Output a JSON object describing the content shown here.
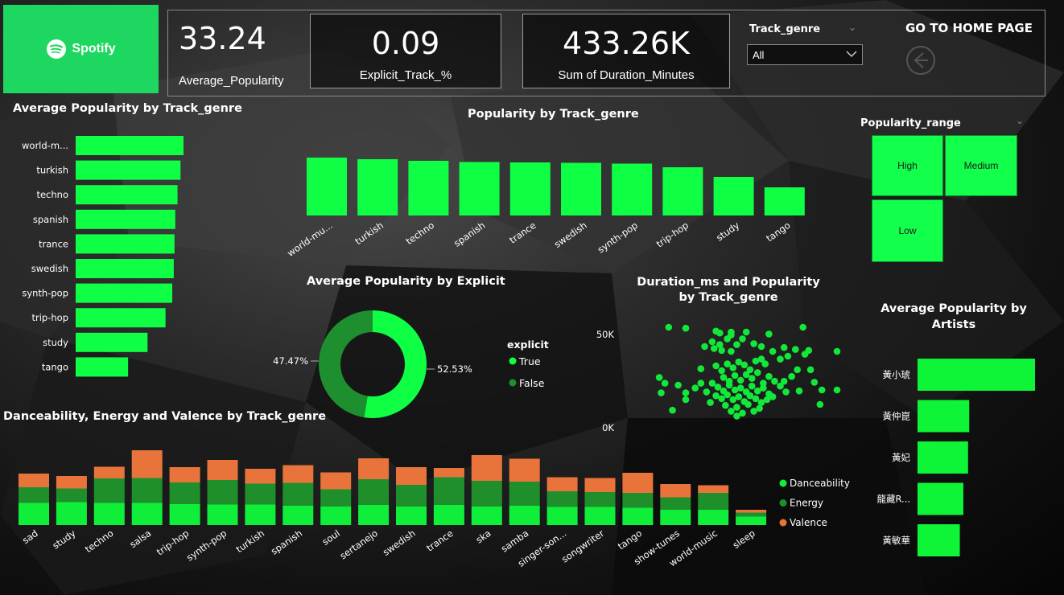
{
  "brand": {
    "name": "Spotify",
    "color": "#1ed760"
  },
  "colors": {
    "bar": "#0fff45",
    "donut_true": "#0fff45",
    "donut_false": "#1e8f2f",
    "dance": "#0fef3a",
    "energy": "#1f8f2c",
    "valence": "#e8743b",
    "scatter": "#12e83a"
  },
  "kpis": [
    {
      "value": "33.24",
      "label": "Average_Popularity"
    },
    {
      "value": "0.09",
      "label": "Explicit_Track_%"
    },
    {
      "value": "433.26K",
      "label": "Sum of Duration_Minutes"
    }
  ],
  "filter": {
    "label": "Track_genre",
    "selected": "All"
  },
  "home": {
    "label": "GO TO HOME PAGE",
    "icon": "arrow-left-circle-icon"
  },
  "popularity_range": {
    "title": "Popularity_range",
    "tiles": [
      "High",
      "Medium",
      "Low"
    ]
  },
  "chart_data": [
    {
      "id": "avg_pop_genre",
      "type": "bar",
      "orientation": "horizontal",
      "title": "Average Popularity by Track_genre",
      "categories": [
        "world-m...",
        "turkish",
        "techno",
        "spanish",
        "trance",
        "swedish",
        "synth-pop",
        "trip-hop",
        "study",
        "tango"
      ],
      "values": [
        72,
        70,
        68,
        66.5,
        66,
        65.5,
        64.5,
        60,
        48,
        35
      ],
      "xlim": [
        0,
        75
      ]
    },
    {
      "id": "pop_genre",
      "type": "bar",
      "title": "Popularity by Track_genre",
      "categories": [
        "world-mu...",
        "turkish",
        "techno",
        "spanish",
        "trance",
        "swedish",
        "synth-pop",
        "trip-hop",
        "study",
        "tango"
      ],
      "values": [
        72,
        70,
        68,
        66.5,
        66,
        65.5,
        64.5,
        60,
        48,
        35
      ],
      "ylim": [
        0,
        75
      ]
    },
    {
      "id": "avg_pop_explicit",
      "type": "pie",
      "title": "Average Popularity by Explicit",
      "legend_title": "explicit",
      "labels": [
        "True",
        "False"
      ],
      "values": [
        52.53,
        47.47
      ],
      "value_labels": [
        "52.53%",
        "47.47%"
      ]
    },
    {
      "id": "duration_pop",
      "type": "scatter",
      "title": "Duration_ms and Popularity by Track_genre",
      "ytick_labels": [
        "50K",
        "0K"
      ],
      "points": [
        [
          0.11,
          0.0
        ],
        [
          0.2,
          0.01
        ],
        [
          0.36,
          0.04
        ],
        [
          0.38,
          0.06
        ],
        [
          0.44,
          0.05
        ],
        [
          0.52,
          0.05
        ],
        [
          0.64,
          0.07
        ],
        [
          0.44,
          0.08
        ],
        [
          0.42,
          0.12
        ],
        [
          0.34,
          0.15
        ],
        [
          0.38,
          0.18
        ],
        [
          0.3,
          0.2
        ],
        [
          0.35,
          0.22
        ],
        [
          0.39,
          0.24
        ],
        [
          0.44,
          0.25
        ],
        [
          0.47,
          0.18
        ],
        [
          0.5,
          0.12
        ],
        [
          0.56,
          0.17
        ],
        [
          0.6,
          0.2
        ],
        [
          0.66,
          0.25
        ],
        [
          0.72,
          0.21
        ],
        [
          0.78,
          0.23
        ],
        [
          0.85,
          0.24
        ],
        [
          0.83,
          0.28
        ],
        [
          0.6,
          0.33
        ],
        [
          0.7,
          0.33
        ],
        [
          0.74,
          0.3
        ],
        [
          0.28,
          0.43
        ],
        [
          0.36,
          0.4
        ],
        [
          0.39,
          0.45
        ],
        [
          0.42,
          0.38
        ],
        [
          0.45,
          0.42
        ],
        [
          0.48,
          0.36
        ],
        [
          0.51,
          0.39
        ],
        [
          0.54,
          0.44
        ],
        [
          0.57,
          0.35
        ],
        [
          0.62,
          0.38
        ],
        [
          0.4,
          0.52
        ],
        [
          0.43,
          0.56
        ],
        [
          0.46,
          0.5
        ],
        [
          0.49,
          0.55
        ],
        [
          0.52,
          0.49
        ],
        [
          0.55,
          0.53
        ],
        [
          0.58,
          0.47
        ],
        [
          0.61,
          0.58
        ],
        [
          0.64,
          0.51
        ],
        [
          0.34,
          0.58
        ],
        [
          0.37,
          0.62
        ],
        [
          0.4,
          0.66
        ],
        [
          0.43,
          0.6
        ],
        [
          0.46,
          0.65
        ],
        [
          0.49,
          0.63
        ],
        [
          0.52,
          0.67
        ],
        [
          0.55,
          0.61
        ],
        [
          0.58,
          0.66
        ],
        [
          0.61,
          0.63
        ],
        [
          0.64,
          0.69
        ],
        [
          0.67,
          0.56
        ],
        [
          0.7,
          0.61
        ],
        [
          0.25,
          0.63
        ],
        [
          0.28,
          0.58
        ],
        [
          0.31,
          0.67
        ],
        [
          0.36,
          0.71
        ],
        [
          0.39,
          0.74
        ],
        [
          0.42,
          0.7
        ],
        [
          0.45,
          0.75
        ],
        [
          0.48,
          0.72
        ],
        [
          0.51,
          0.77
        ],
        [
          0.54,
          0.71
        ],
        [
          0.57,
          0.74
        ],
        [
          0.6,
          0.78
        ],
        [
          0.63,
          0.75
        ],
        [
          0.66,
          0.72
        ],
        [
          0.33,
          0.78
        ],
        [
          0.41,
          0.81
        ],
        [
          0.47,
          0.83
        ],
        [
          0.53,
          0.8
        ],
        [
          0.59,
          0.84
        ],
        [
          0.44,
          0.87
        ],
        [
          0.5,
          0.89
        ],
        [
          0.56,
          0.87
        ],
        [
          0.47,
          0.92
        ],
        [
          0.13,
          0.86
        ],
        [
          0.2,
          0.75
        ],
        [
          0.07,
          0.68
        ],
        [
          0.09,
          0.58
        ],
        [
          0.06,
          0.52
        ],
        [
          0.16,
          0.6
        ],
        [
          0.2,
          0.68
        ],
        [
          0.73,
          0.67
        ],
        [
          0.72,
          0.56
        ],
        [
          0.79,
          0.44
        ],
        [
          0.86,
          0.44
        ],
        [
          0.91,
          0.8
        ],
        [
          0.92,
          0.65
        ],
        [
          0.88,
          0.57
        ],
        [
          0.8,
          0.66
        ],
        [
          0.76,
          0.51
        ],
        [
          1.0,
          0.65
        ],
        [
          1.0,
          0.25
        ],
        [
          0.82,
          0.0
        ]
      ]
    },
    {
      "id": "avg_pop_artists",
      "type": "bar",
      "orientation": "horizontal",
      "title": "Average Popularity by Artists",
      "categories": [
        "黃小琥",
        "黃仲崑",
        "黃妃",
        "龍藏R...",
        "黃敏華"
      ],
      "values": [
        100,
        44,
        43,
        39,
        36
      ],
      "xlim": [
        0,
        100
      ]
    },
    {
      "id": "dev_genre",
      "type": "bar",
      "stacked": true,
      "title": "Danceability, Energy and Valence by Track_genre",
      "categories": [
        "sad",
        "study",
        "techno",
        "salsa",
        "trip-hop",
        "synth-pop",
        "turkish",
        "spanish",
        "soul",
        "sertanejo",
        "swedish",
        "trance",
        "ska",
        "samba",
        "singer-son...",
        "songwriter",
        "tango",
        "show-tunes",
        "world-music",
        "sleep"
      ],
      "series": [
        {
          "name": "Danceability",
          "values": [
            0.55,
            0.57,
            0.55,
            0.55,
            0.52,
            0.51,
            0.51,
            0.48,
            0.46,
            0.5,
            0.46,
            0.5,
            0.46,
            0.48,
            0.45,
            0.45,
            0.43,
            0.38,
            0.38,
            0.21
          ]
        },
        {
          "name": "Energy",
          "values": [
            0.39,
            0.34,
            0.61,
            0.62,
            0.54,
            0.61,
            0.52,
            0.57,
            0.43,
            0.64,
            0.54,
            0.69,
            0.64,
            0.6,
            0.39,
            0.37,
            0.37,
            0.31,
            0.42,
            0.1
          ]
        },
        {
          "name": "Valence",
          "values": [
            0.34,
            0.31,
            0.29,
            0.71,
            0.38,
            0.5,
            0.37,
            0.44,
            0.42,
            0.52,
            0.44,
            0.23,
            0.64,
            0.57,
            0.35,
            0.35,
            0.5,
            0.33,
            0.19,
            0.07
          ]
        }
      ],
      "ylim": [
        0,
        2.0
      ]
    }
  ]
}
